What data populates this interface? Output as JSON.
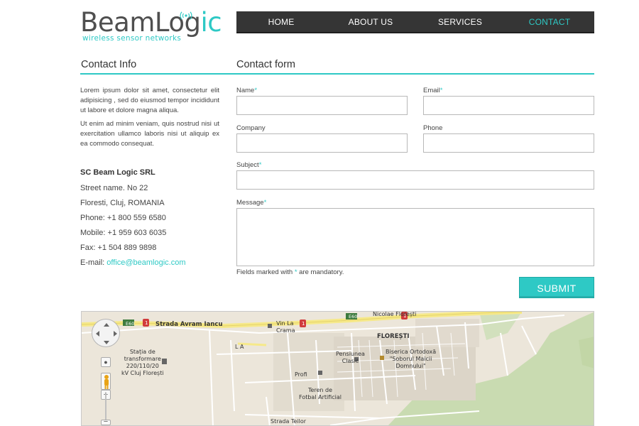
{
  "brand": {
    "name_part1": "BeamLog",
    "name_part2": "ic",
    "tagline": "wireless sensor networks",
    "accent_color": "#2ec9c5"
  },
  "nav": {
    "items": [
      {
        "label": "HOME",
        "active": false
      },
      {
        "label": "ABOUT US",
        "active": false
      },
      {
        "label": "SERVICES",
        "active": false
      },
      {
        "label": "CONTACT",
        "active": true
      }
    ]
  },
  "contact_info": {
    "heading": "Contact Info",
    "para1": "Lorem ipsum dolor sit amet, consectetur elit adipisicing , sed do eiusmod tempor incididunt ut labore et dolore magna aliqua.",
    "para2": "Ut enim ad minim veniam, quis nostrud nisi ut exercitation ullamco laboris nisi ut aliquip ex ea commodo consequat.",
    "company": "SC Beam Logic SRL",
    "street": "Street name. No 22",
    "city": "Floresti, Cluj, ROMANIA",
    "phone": "Phone: +1 800 559 6580",
    "mobile": "Mobile: +1 959 603 6035",
    "fax": "Fax: +1 504 889 9898",
    "email_label": "E-mail: ",
    "email": "office@beamlogic.com"
  },
  "form": {
    "heading": "Contact form",
    "name_label": "Name",
    "email_label": "Email",
    "company_label": "Company",
    "phone_label": "Phone",
    "subject_label": "Subject",
    "message_label": "Message",
    "required_mark": "*",
    "name_value": "",
    "email_value": "",
    "company_value": "",
    "phone_value": "",
    "subject_value": "",
    "message_value": "",
    "note_before": "Fields marked with ",
    "note_after": " are mandatory.",
    "submit_label": "SUBMIT"
  },
  "map": {
    "labels": {
      "e60_1": "E60",
      "e60_2": "E60",
      "e60_3": "E60",
      "road1": "1",
      "road2": "1",
      "road3": "1",
      "strada_avram": "Strada Avram Iancu",
      "nicolae": "Nicolae   Florești",
      "vin_la_crama": "Vin La\nCrama",
      "floresti": "FLOREȘTI",
      "la": "L A",
      "statia": "Stația de\ntransformare\n220/110/20\nkV Cluj Florești",
      "pensiunea": "Pensiunea\nClasic",
      "biserica": "Biserica Ortodoxă\n\"Soborul Maicii\nDomnului\"",
      "profi": "Profi",
      "teren": "Teren de\nFotbal Artificial",
      "strada_teilor": "Strada Teilor"
    },
    "colors": {
      "land": "#ece6da",
      "green": "#c9dbb1",
      "road_main": "#f6e98a",
      "road_minor": "#ffffff",
      "blocks": "#dcd5c8"
    }
  }
}
